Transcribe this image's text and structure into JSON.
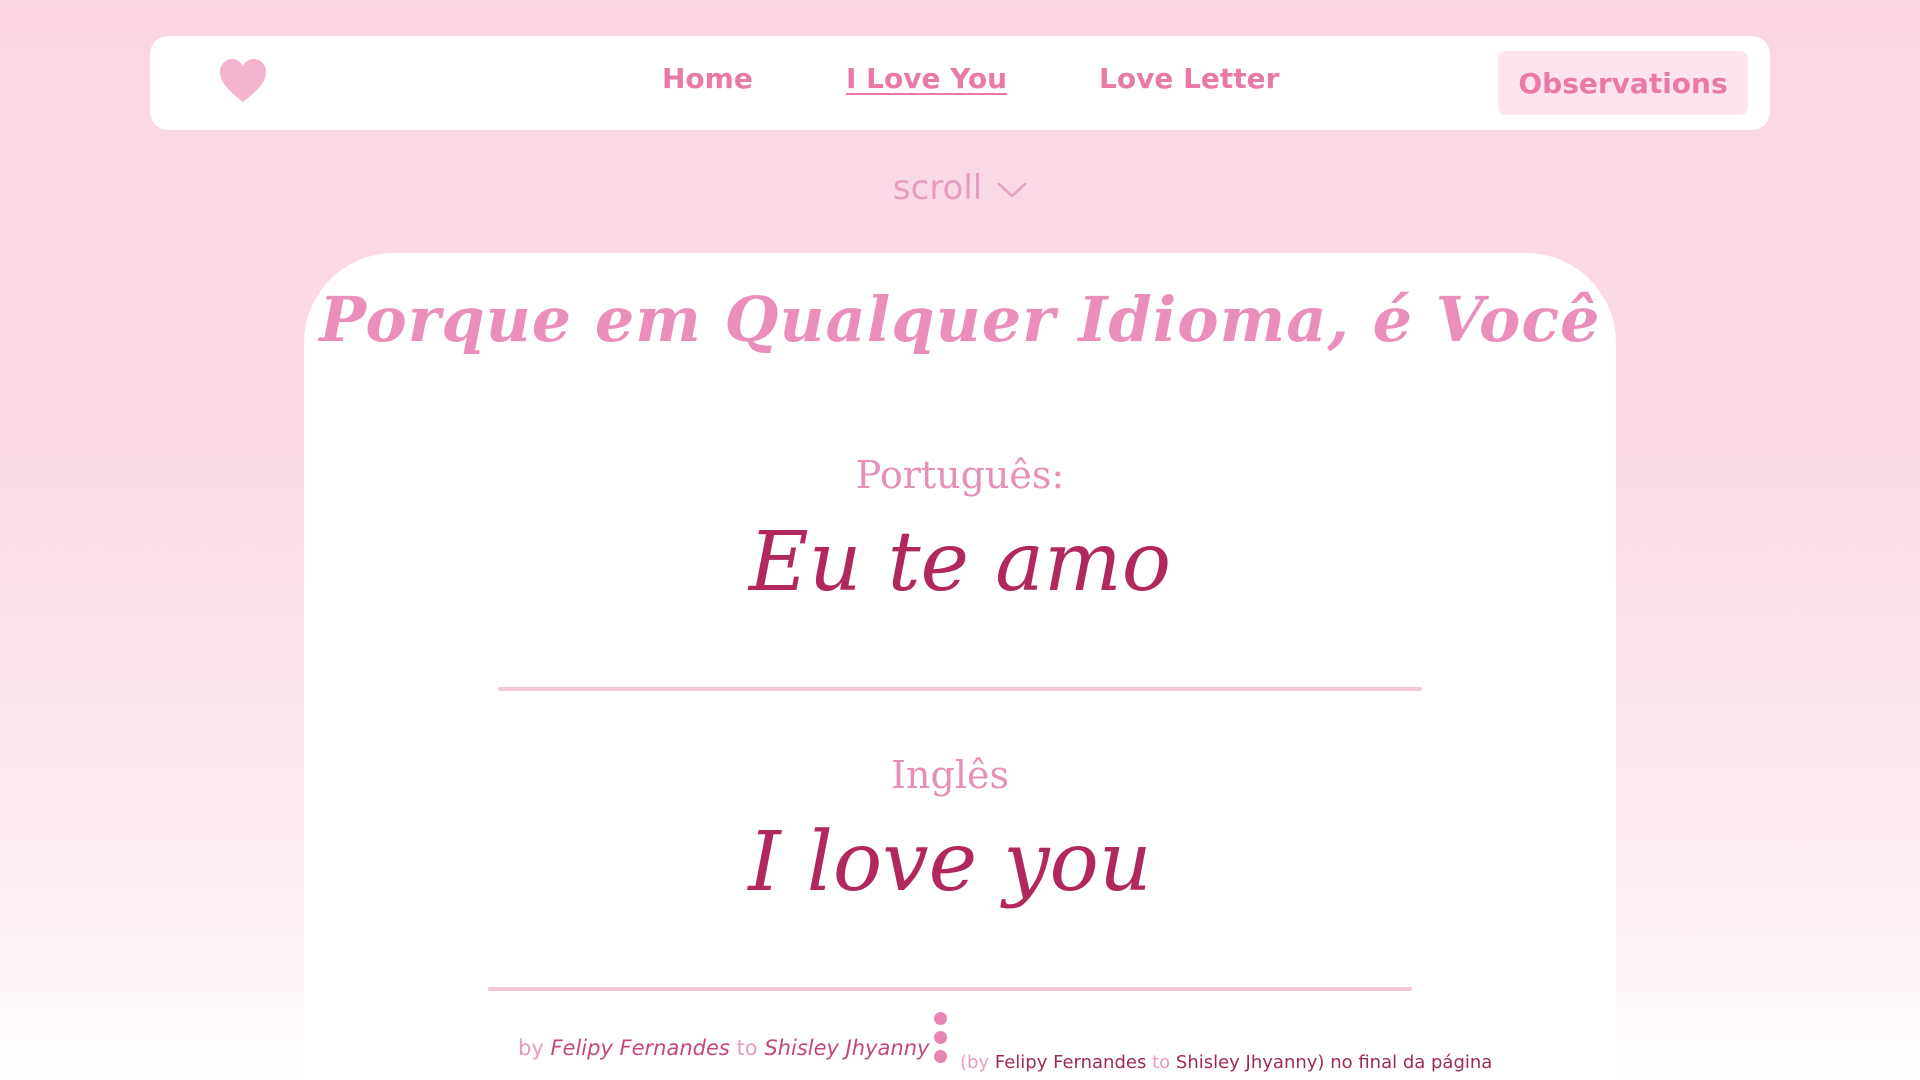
{
  "nav": {
    "logo_icon": "heart-icon",
    "links": [
      {
        "label": "Home"
      },
      {
        "label": "I Love You"
      },
      {
        "label": "Love Letter"
      }
    ],
    "observations_label": "Observations",
    "accent_color": "#e879a9"
  },
  "scroll_hint": {
    "label": "scroll",
    "icon": "chevron-down-icon"
  },
  "card": {
    "title": "Porque em Qualquer Idioma, é Você",
    "entries": [
      {
        "language": "Português:",
        "phrase": "Eu te amo"
      },
      {
        "language": "Inglês",
        "phrase": "I love you"
      }
    ],
    "phrase_color": "#b0285e"
  },
  "footer": {
    "credit_left": {
      "by": "by",
      "author": "Felipy Fernandes",
      "to": "to",
      "recipient": "Shisley Jhyanny"
    },
    "menu_icon": "vertical-dots-icon",
    "credit_right": {
      "open": "(by",
      "author": "Felipy Fernandes",
      "to": "to",
      "recipient": "Shisley Jhyanny)",
      "tail": "no final da página"
    }
  }
}
